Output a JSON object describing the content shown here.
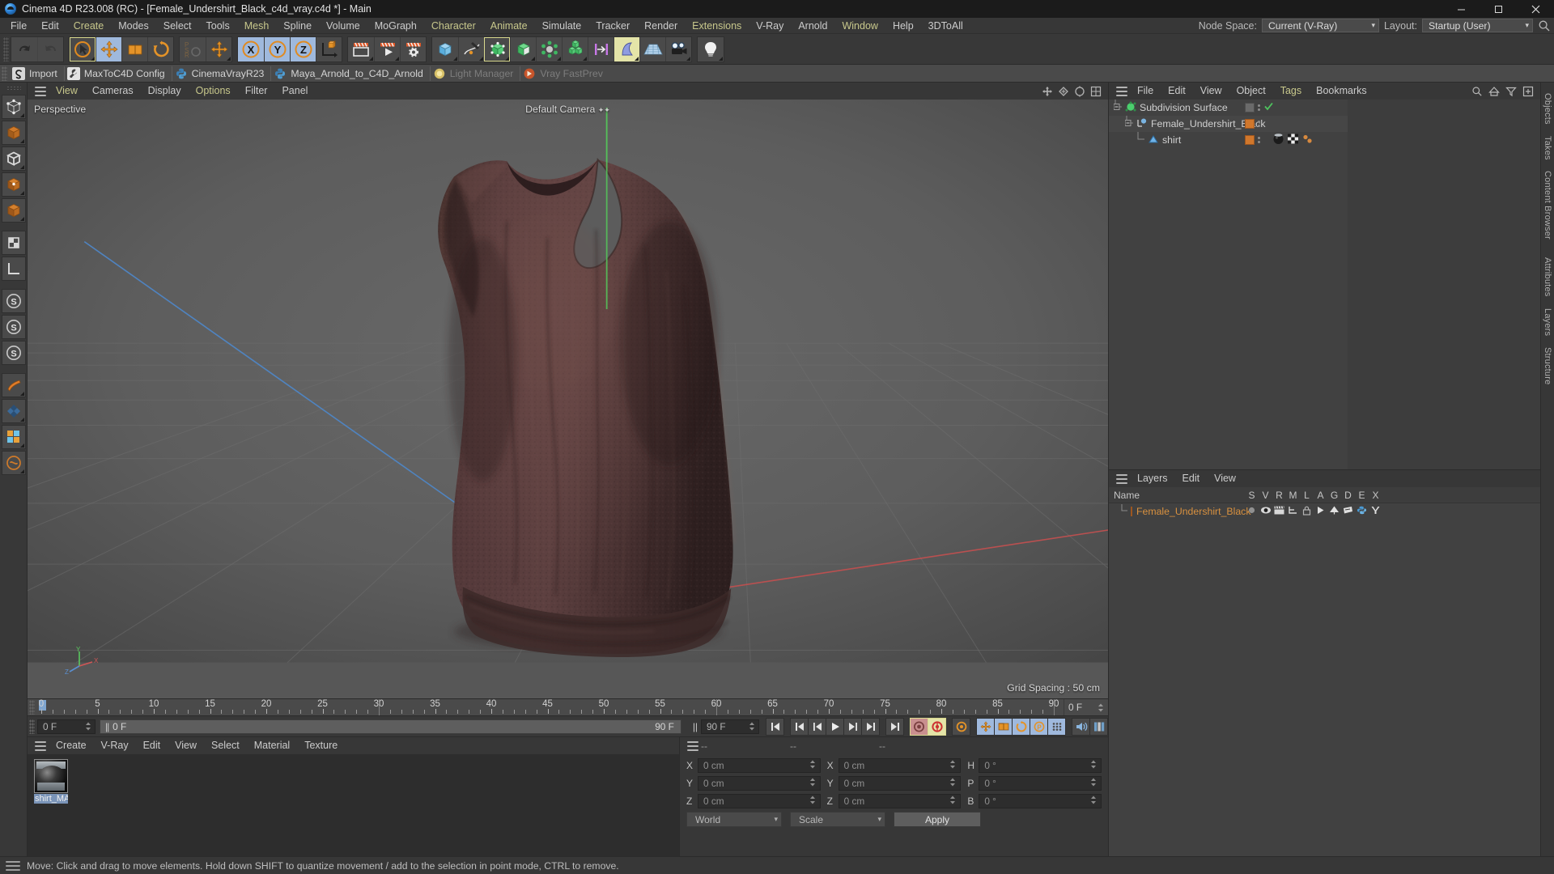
{
  "window": {
    "title": "Cinema 4D R23.008 (RC) - [Female_Undershirt_Black_c4d_vray.c4d *] - Main",
    "minimize": "–",
    "maximize": "❐",
    "close": "✕"
  },
  "menubar": {
    "items": [
      {
        "label": "File",
        "hl": false
      },
      {
        "label": "Edit",
        "hl": false
      },
      {
        "label": "Create",
        "hl": true
      },
      {
        "label": "Modes",
        "hl": false
      },
      {
        "label": "Select",
        "hl": false
      },
      {
        "label": "Tools",
        "hl": false
      },
      {
        "label": "Mesh",
        "hl": true
      },
      {
        "label": "Spline",
        "hl": false
      },
      {
        "label": "Volume",
        "hl": false
      },
      {
        "label": "MoGraph",
        "hl": false
      },
      {
        "label": "Character",
        "hl": true
      },
      {
        "label": "Animate",
        "hl": true
      },
      {
        "label": "Simulate",
        "hl": false
      },
      {
        "label": "Tracker",
        "hl": false
      },
      {
        "label": "Render",
        "hl": false
      },
      {
        "label": "Extensions",
        "hl": true
      },
      {
        "label": "V-Ray",
        "hl": false
      },
      {
        "label": "Arnold",
        "hl": false
      },
      {
        "label": "Window",
        "hl": true
      },
      {
        "label": "Help",
        "hl": false
      },
      {
        "label": "3DToAll",
        "hl": false
      }
    ],
    "node_space_label": "Node Space:",
    "node_space_value": "Current (V-Ray)",
    "layout_label": "Layout:",
    "layout_value": "Startup (User)"
  },
  "pluginbar": {
    "items": [
      {
        "label": "Import",
        "icon": "spiral-icon",
        "disabled": false
      },
      {
        "label": "MaxToC4D Config",
        "icon": "wrench-icon",
        "disabled": false
      },
      {
        "label": "CinemaVrayR23",
        "icon": "python-icon",
        "disabled": false
      },
      {
        "label": "Maya_Arnold_to_C4D_Arnold",
        "icon": "python-icon",
        "disabled": false
      },
      {
        "label": "Light Manager",
        "icon": "light-icon",
        "disabled": true
      },
      {
        "label": "Vray FastPrev",
        "icon": "vray-icon",
        "disabled": true
      }
    ]
  },
  "viewport": {
    "menu": [
      {
        "label": "View",
        "hl": true
      },
      {
        "label": "Cameras",
        "hl": false
      },
      {
        "label": "Display",
        "hl": false
      },
      {
        "label": "Options",
        "hl": true
      },
      {
        "label": "Filter",
        "hl": false
      },
      {
        "label": "Panel",
        "hl": false
      }
    ],
    "perspective_label": "Perspective",
    "camera_label": "Default Camera",
    "grid_spacing": "Grid Spacing : 50 cm",
    "axis": {
      "x": "X",
      "y": "Y",
      "z": "Z"
    }
  },
  "timeline": {
    "ticks": [
      0,
      5,
      10,
      15,
      20,
      25,
      30,
      35,
      40,
      45,
      50,
      55,
      60,
      65,
      70,
      75,
      80,
      85,
      90
    ],
    "min_frame": "0 F",
    "max_frame": "90 F",
    "current_frame": "0 F",
    "preview_min": "0 F",
    "preview_max": "90 F",
    "end_field": "0 F"
  },
  "material_manager": {
    "menu": [
      "Create",
      "V-Ray",
      "Edit",
      "View",
      "Select",
      "Material",
      "Texture"
    ],
    "materials": [
      {
        "name": "shirt_MA",
        "selected": true
      }
    ]
  },
  "coordinates": {
    "headers": [
      "--",
      "--",
      "--"
    ],
    "rows": [
      {
        "a_axis": "X",
        "a_val": "0 cm",
        "b_axis": "X",
        "b_val": "0 cm",
        "c_axis": "H",
        "c_val": "0 °"
      },
      {
        "a_axis": "Y",
        "a_val": "0 cm",
        "b_axis": "Y",
        "b_val": "0 cm",
        "c_axis": "P",
        "c_val": "0 °"
      },
      {
        "a_axis": "Z",
        "a_val": "0 cm",
        "b_axis": "Z",
        "b_val": "0 cm",
        "c_axis": "B",
        "c_val": "0 °"
      }
    ],
    "space": "World",
    "mode": "Scale",
    "apply": "Apply"
  },
  "object_manager": {
    "menu": [
      {
        "label": "File",
        "hl": false
      },
      {
        "label": "Edit",
        "hl": false
      },
      {
        "label": "View",
        "hl": false
      },
      {
        "label": "Object",
        "hl": false
      },
      {
        "label": "Tags",
        "hl": true
      },
      {
        "label": "Bookmarks",
        "hl": false
      }
    ],
    "objects": [
      {
        "name": "Subdivision Surface",
        "depth": 0,
        "icon": "subdivision-surface-icon",
        "swatch": "gray",
        "checked": true
      },
      {
        "name": "Female_Undershirt_Black",
        "depth": 1,
        "icon": "null-object-icon",
        "swatch": "orange",
        "checked": false
      },
      {
        "name": "shirt",
        "depth": 2,
        "icon": "polygon-object-icon",
        "swatch": "orange",
        "checked": false,
        "tags": [
          "material-tag",
          "uvw-tag",
          "selection-tag"
        ]
      }
    ]
  },
  "layer_manager": {
    "menu": [
      "Layers",
      "Edit",
      "View"
    ],
    "name_header": "Name",
    "columns": [
      "S",
      "V",
      "R",
      "M",
      "L",
      "A",
      "G",
      "D",
      "E",
      "X"
    ],
    "rows": [
      {
        "name": "Female_Undershirt_Black",
        "color": "#d0772c"
      }
    ]
  },
  "right_tabs_top": [
    "Objects",
    "Takes",
    "Content Browser"
  ],
  "right_tabs_bottom": [
    "Attributes",
    "Layers",
    "Structure"
  ],
  "statusbar": {
    "message": "Move: Click and drag to move elements. Hold down SHIFT to quantize movement / add to the selection in point mode, CTRL to remove."
  },
  "colors": {
    "accent_orange": "#e08a20",
    "selection_blue": "#9fb9dd",
    "selection_yellow": "#e4e4a8",
    "panel_bg": "#373737",
    "layer_orange": "#d0772c"
  }
}
